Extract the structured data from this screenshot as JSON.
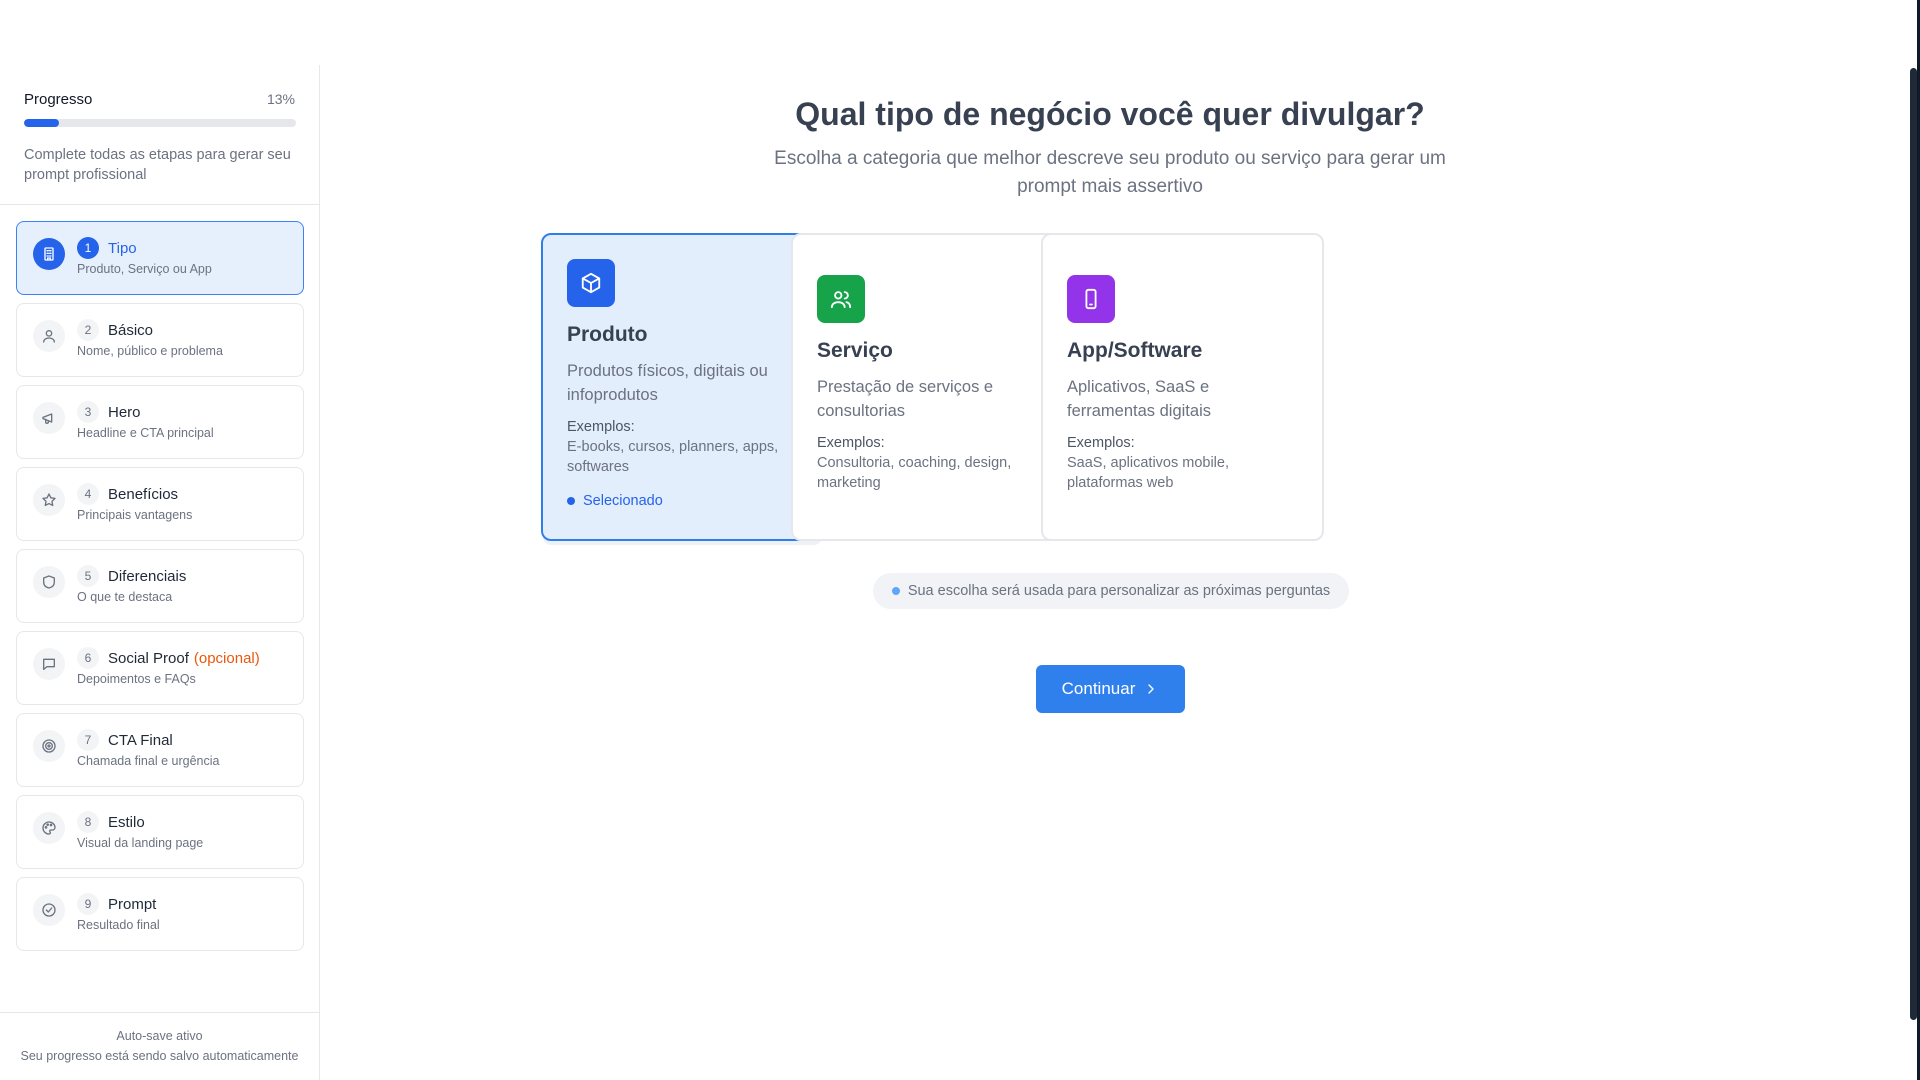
{
  "sidebar": {
    "progress": {
      "label": "Progresso",
      "percent_text": "13%",
      "value": 0.13,
      "description": "Complete todas as etapas para gerar seu prompt profissional"
    },
    "steps": [
      {
        "num": "1",
        "title": "Tipo",
        "optional": "",
        "subtitle": "Produto, Serviço ou App",
        "icon": "building-icon",
        "active": true
      },
      {
        "num": "2",
        "title": "Básico",
        "optional": "",
        "subtitle": "Nome, público e problema",
        "icon": "user-icon",
        "active": false
      },
      {
        "num": "3",
        "title": "Hero",
        "optional": "",
        "subtitle": "Headline e CTA principal",
        "icon": "megaphone-icon",
        "active": false
      },
      {
        "num": "4",
        "title": "Benefícios",
        "optional": "",
        "subtitle": "Principais vantagens",
        "icon": "star-icon",
        "active": false
      },
      {
        "num": "5",
        "title": "Diferenciais",
        "optional": "",
        "subtitle": "O que te destaca",
        "icon": "shield-icon",
        "active": false
      },
      {
        "num": "6",
        "title": "Social Proof",
        "optional": "(opcional)",
        "subtitle": "Depoimentos e FAQs",
        "icon": "message-icon",
        "active": false
      },
      {
        "num": "7",
        "title": "CTA Final",
        "optional": "",
        "subtitle": "Chamada final e urgência",
        "icon": "target-icon",
        "active": false
      },
      {
        "num": "8",
        "title": "Estilo",
        "optional": "",
        "subtitle": "Visual da landing page",
        "icon": "palette-icon",
        "active": false
      },
      {
        "num": "9",
        "title": "Prompt",
        "optional": "",
        "subtitle": "Resultado final",
        "icon": "check-circle-icon",
        "active": false
      }
    ],
    "autosave": {
      "title": "Auto-save ativo",
      "description": "Seu progresso está sendo salvo automaticamente"
    }
  },
  "main": {
    "heading": "Qual tipo de negócio você quer divulgar?",
    "subheading": "Escolha a categoria que melhor descreve seu produto ou serviço para gerar um prompt mais assertivo",
    "cards": [
      {
        "title": "Produto",
        "description": "Produtos físicos, digitais ou infoprodutos",
        "examples_label": "Exemplos:",
        "examples": "E-books, cursos, planners, apps, softwares",
        "selected_label": "Selecionado",
        "selected": true,
        "icon": "package-icon",
        "color": "#2563eb"
      },
      {
        "title": "Serviço",
        "description": "Prestação de serviços e consultorias",
        "examples_label": "Exemplos:",
        "examples": "Consultoria, coaching, design, marketing",
        "selected_label": "",
        "selected": false,
        "icon": "users-icon",
        "color": "#16a34a"
      },
      {
        "title": "App/Software",
        "description": "Aplicativos, SaaS e ferramentas digitais",
        "examples_label": "Exemplos:",
        "examples": "SaaS, aplicativos mobile, plataformas web",
        "selected_label": "",
        "selected": false,
        "icon": "smartphone-icon",
        "color": "#9333ea"
      }
    ],
    "hint": "Sua escolha será usada para personalizar as próximas perguntas",
    "continue_label": "Continuar"
  },
  "colors": {
    "accent": "#2563eb",
    "optional": "#ea580c",
    "service": "#16a34a",
    "app": "#9333ea"
  }
}
